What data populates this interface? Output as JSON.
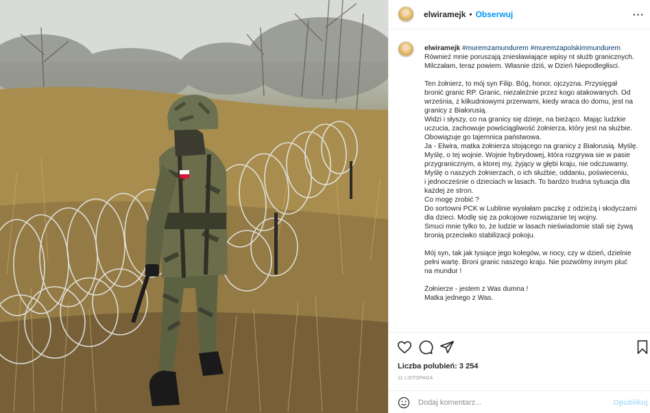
{
  "post": {
    "username": "elwiramejk",
    "separator": "•",
    "follow_label": "Obserwuj",
    "more_label": "···"
  },
  "caption": {
    "username": "elwiramejk",
    "hashtags": "#muremzamundurem #muremzapolskimmundurem",
    "text": "Również mnie poruszają zniesławiające wpisy nt służb granicznych.\nMilczałam, teraz powiem. Własnie dziś, w Dzień Niepodległisci.\n\nTen żołnierz, to mój syn Filip. Bóg, honor, ojczyzna. Przysięgał\nbronić granic RP. Granic, niezależnie przez kogo atakowanych. Od\nwrześnia, z kilkudniowymi przerwami, kiedy wraca do domu, jest na\ngranicy z Białorusią.\nWidzi i słyszy, co na granicy się dzieje, na bieżąco. Mając ludzkie\nuczucia, zachowuje powściągliwość żołnierza, który jest na służbie.\nObowiązuje go tajemnica państwowa.\nJa - Elwira, matka żołnierza stojącego na granicy z Białorusią. Myślę.\nMyślę, o tej wojnie. Wojnie hybrydowej, która rozgrywa sie w pasie\nprzygranicznym, a ktorej my, żyjący w głębi kraju, nie odczuwamy.\nMyślę o naszych żołnierzach, o ich służbie, oddaniu, poświeceniu,\ni jednocześnie o dzieciach w lasach. To bardzo trudna sytuacja dla\nkażdej ze stron.\nCo mogę zrobić ?\nDo sortowni PCK w Lublinie wysłałam paczkę z odzieżą i słodyczami\ndla dzieci. Modlę się za pokojowe rozwiązanie tej wojny.\nSmuci mnie tylko to, że ludzie w lasach nieświadomie stali się żywą\nbronią przeciwko stabilizacji pokoju.\n\nMój syn, tak jak tysiące jego kolegów, w nocy, czy w dzień, dzielnie\npełni wartę. Broni granic naszego kraju. Nie pozwólmy innym pluć\nna mundur !\n\nŻołnierze - jestem z Was dumna !\nMatka jednego z Was."
  },
  "actions": {
    "like_icon": "heart-icon",
    "comment_icon": "comment-bubble-icon",
    "share_icon": "paper-plane-icon",
    "save_icon": "bookmark-icon"
  },
  "likes_text": "Liczba polubień: 3 254",
  "date_text": "11 LISTOPADA",
  "comment": {
    "emoji_icon": "smiley-icon",
    "placeholder": "Dodaj komentarz...",
    "publish_label": "Opublikuj"
  },
  "photo": {
    "description_icon": "photo",
    "flag_colors": [
      "#ffffff",
      "#dc143c"
    ]
  }
}
